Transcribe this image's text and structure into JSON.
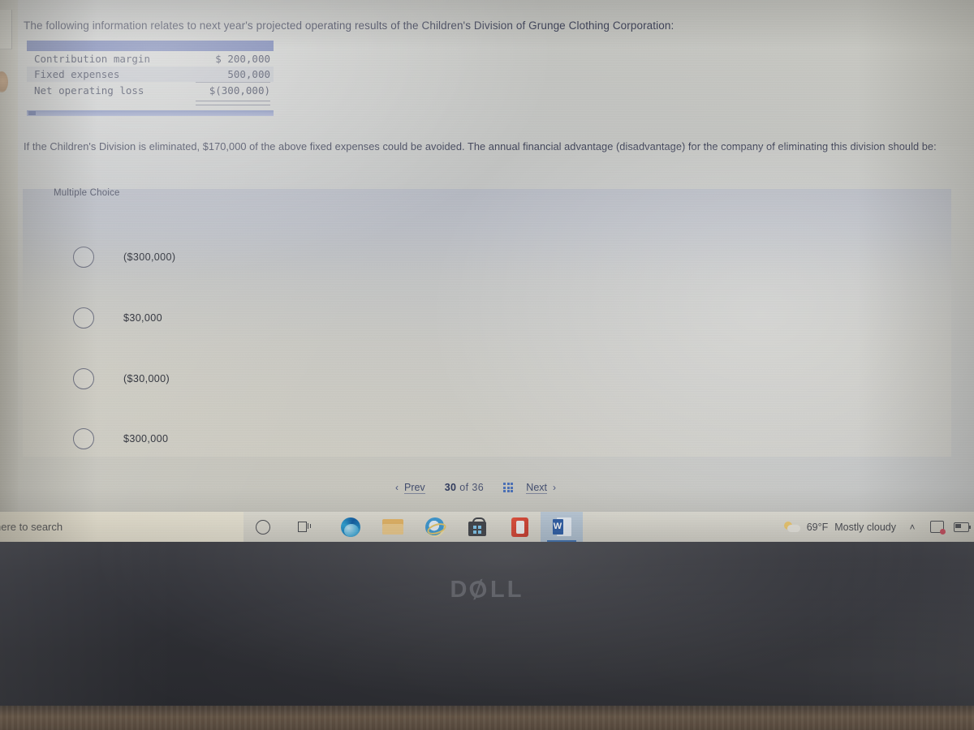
{
  "question": {
    "stem": "The following information relates to next year's projected operating results of the Children's Division of Grunge Clothing Corporation:",
    "tail": "If the Children's Division is eliminated, $170,000 of the above fixed expenses could be avoided. The annual financial advantage (disadvantage) for the company of eliminating this division should be:"
  },
  "table": {
    "rows": [
      {
        "label": "Contribution margin",
        "amount": "$ 200,000"
      },
      {
        "label": "Fixed expenses",
        "amount": "  500,000"
      },
      {
        "label": "Net operating loss",
        "amount": "$(300,000)"
      }
    ]
  },
  "answers": {
    "section_label": "Multiple Choice",
    "options": [
      {
        "text": "($300,000)"
      },
      {
        "text": "$30,000"
      },
      {
        "text": "($30,000)"
      },
      {
        "text": "$300,000"
      }
    ]
  },
  "pager": {
    "prev_label": "Prev",
    "next_label": "Next",
    "current": "30",
    "of_label": "of",
    "total": "36",
    "prev_chevron": "‹",
    "next_chevron": "›"
  },
  "taskbar": {
    "search_text": "here to search",
    "apps": [
      {
        "name": "Microsoft Edge"
      },
      {
        "name": "File Explorer"
      },
      {
        "name": "Internet Explorer"
      },
      {
        "name": "Microsoft Store"
      },
      {
        "name": "Office"
      },
      {
        "name": "Word",
        "letter": "W",
        "active": true
      }
    ],
    "tray": {
      "temperature": "69°F",
      "condition": "Mostly cloudy",
      "overflow_chevron": "˄"
    }
  },
  "bezel": {
    "brand": "D",
    "brand_o": "Ø",
    "brand_rest": "LL"
  },
  "colors": {
    "table_header": "#6d7aad",
    "accent_blue": "#4a6fb5",
    "question_text": "#3c4057"
  }
}
